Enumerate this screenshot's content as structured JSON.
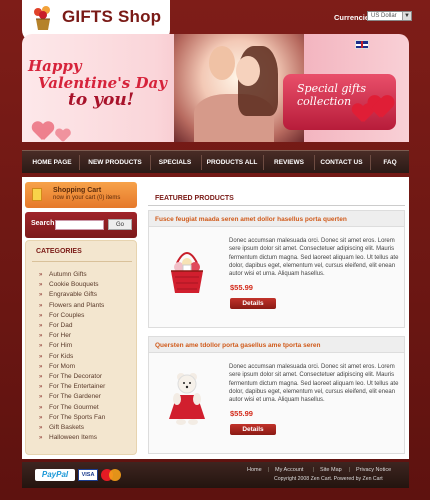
{
  "header": {
    "logo_text": "GIFTS Shop",
    "currencies_label": "Currencies:",
    "currency_selected": "US Dollar"
  },
  "banner": {
    "title_line1": "Happy",
    "title_line2": "Valentine's Day",
    "title_line3": "to you!",
    "special_text": "Special gifts collection"
  },
  "nav": {
    "items": [
      {
        "label": "HOME PAGE"
      },
      {
        "label": "NEW PRODUCTS"
      },
      {
        "label": "SPECIALS"
      },
      {
        "label": "PRODUCTS ALL"
      },
      {
        "label": "REVIEWS"
      },
      {
        "label": "CONTACT US"
      },
      {
        "label": "FAQ"
      }
    ]
  },
  "cart": {
    "title": "Shopping Cart",
    "subtitle": "now in your cart  (0) items"
  },
  "search": {
    "label": "Search",
    "input_value": "",
    "button_label": "Go"
  },
  "categories": {
    "title": "CATEGORIES",
    "items": [
      "Autumn Gifts",
      "Cookie Bouquets",
      "Engravable Gifts",
      "Flowers and Plants",
      "For Couples",
      "For Dad",
      "For Her",
      "For Him",
      "For Kids",
      "For Mom",
      "For The Decorator",
      "For The Entertainer",
      "For The Gardener",
      "For The Gourmet",
      "For The Sports Fan",
      "Gift Baskets",
      "Halloween Items"
    ]
  },
  "featured": {
    "title": "FEATURED PRODUCTS",
    "products": [
      {
        "title": "Fusce feugiat maada seren amet dollor hasellus porta querten",
        "description": "Donec accumsan malesuada orci. Donec sit amet eros. Lorem sere ipsum dolor sit amet. Consectetuer adipiscing elit. Mauris fermentum dictum magna. Sed laoreet aliquam leo. Ut tellus ate dolor, dapibus eget, elementum vel, cursus eleifend, elit enean autor wisi et urna. Aliquam hasellus.",
        "price": "$55.99",
        "button_label": "Details"
      },
      {
        "title": "Quersten ame tdollor porta gasellus ame tporta seren",
        "description": "Donec accumsan malesuada orci. Donec sit amet eros. Lorem sere ipsum dolor sit amet. Consectetuer adipiscing elit. Mauris fermentum dictum magna. Sed laoreet aliquam leo. Ut tellus ate dolor, dapibus eget, elementum vel, cursus eleifend, elit enean autor wisi et urna. Aliquam hasellus.",
        "price": "$55.99",
        "button_label": "Details"
      }
    ]
  },
  "footer": {
    "paypal": "PayPal",
    "visa": "VISA",
    "links": [
      "Home",
      "My Account",
      "Site Map",
      "Privacy Notice"
    ],
    "copyright": "Copyright  2008 Zen Cart. Powered by Zen Cart"
  },
  "colors": {
    "brand_dark_red": "#7a1a16",
    "accent_orange": "#e5782a",
    "price_red": "#d32a1a",
    "title_orange": "#d05a1a"
  },
  "icons": [
    "gift-logo-icon",
    "uk-flag-icon",
    "cart-icon",
    "bullet-icon",
    "paypal-logo",
    "visa-logo",
    "mastercard-logo"
  ]
}
